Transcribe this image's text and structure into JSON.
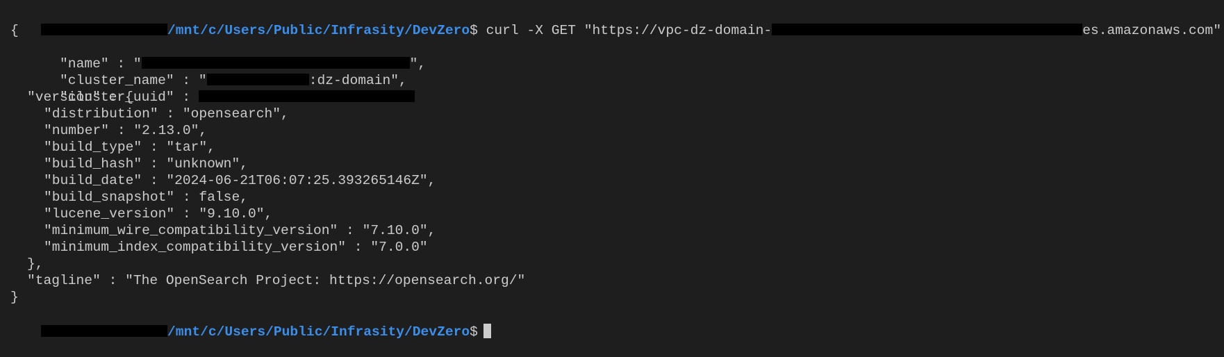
{
  "prompt": {
    "path": "/mnt/c/Users/Public/Infrasity/DevZero",
    "symbol": "$"
  },
  "command": {
    "before_redaction": "curl -X GET \"https://vpc-dz-domain-",
    "after_redaction": "es.amazonaws.com\""
  },
  "output": {
    "open_brace": "{",
    "name_open": "\"name\" : \"",
    "name_close": "\",",
    "cluster_name_open": "\"cluster_name\" : \"",
    "cluster_name_suffix": ":dz-domain\",",
    "cluster_uuid_key": "\"cluster_uuid\" : ",
    "version_open": "\"version\" : {",
    "distribution": "\"distribution\" : \"opensearch\",",
    "number": "\"number\" : \"2.13.0\",",
    "build_type": "\"build_type\" : \"tar\",",
    "build_hash": "\"build_hash\" : \"unknown\",",
    "build_date": "\"build_date\" : \"2024-06-21T06:07:25.393265146Z\",",
    "build_snapshot": "\"build_snapshot\" : false,",
    "lucene_version": "\"lucene_version\" : \"9.10.0\",",
    "min_wire": "\"minimum_wire_compatibility_version\" : \"7.10.0\",",
    "min_index": "\"minimum_index_compatibility_version\" : \"7.0.0\"",
    "version_close": "},",
    "tagline": "\"tagline\" : \"The OpenSearch Project: https://opensearch.org/\"",
    "close_brace": "}"
  },
  "colors": {
    "background": "#1e1e1e",
    "text": "#cccccc",
    "prompt_path": "#3b8eea",
    "redaction": "#000000"
  }
}
